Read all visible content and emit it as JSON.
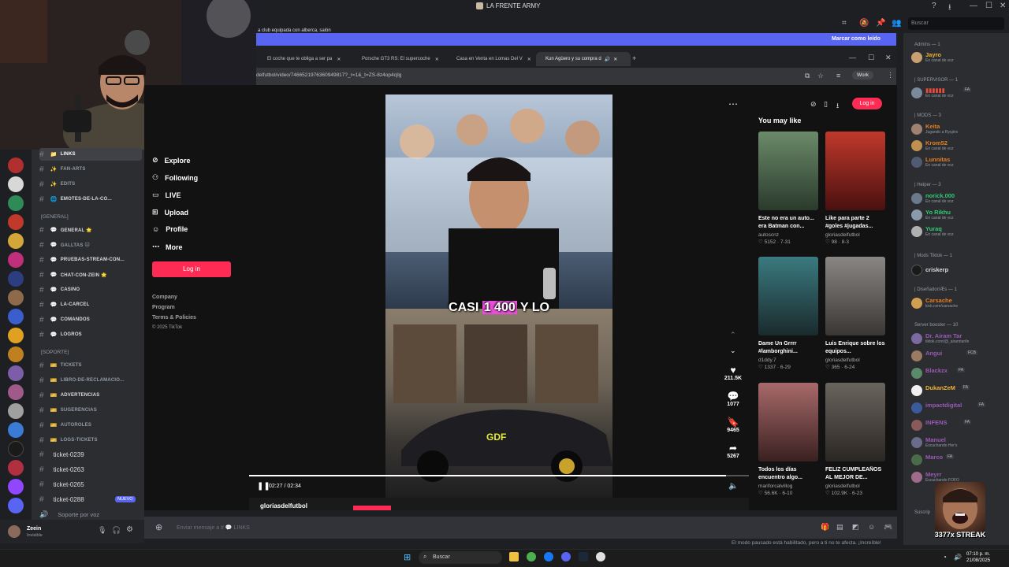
{
  "window": {
    "server_title": "LA FRENTE ARMY",
    "search_placeholder": "Buscar"
  },
  "notification": {
    "text": "a club equipada con alberca, salón",
    "action": "Marcar como leído"
  },
  "browser": {
    "tabs": [
      {
        "label": "El coche que te obliga a ser pa"
      },
      {
        "label": "Porsche GT3 RS: El supercoche"
      },
      {
        "label": "Casa en Venta en Lomas Del V"
      },
      {
        "label": "Kun Agüero y su compra d"
      }
    ],
    "url": "delfutbol/video/7466521976360949817?_r=1&_t=ZS-8z4op4cjlg",
    "profile_label": "Work"
  },
  "tiktok": {
    "nav": [
      "Explore",
      "Following",
      "LIVE",
      "Upload",
      "Profile",
      "More"
    ],
    "login_label": "Log in",
    "footer": [
      "Company",
      "Program",
      "Terms & Policies",
      "© 2025 TikTok"
    ],
    "video": {
      "caption_pre": "CASI ",
      "caption_hl": "1 400",
      "caption_post": " Y LO",
      "overlay": "GDF",
      "time": "02:27 / 02:34",
      "author": "gloriasdelfutbol",
      "progress": 0.955
    },
    "actions": {
      "likes": "211.5K",
      "comments": "1077",
      "saves": "9465",
      "shares": "5267"
    },
    "you_may_like": "You may like",
    "cards": [
      {
        "title": "Este no era un auto... era Batman con...",
        "author": "autoscnz",
        "stats": "♡ 5152 · 7-31",
        "color": "#3b4a3c"
      },
      {
        "title": "Like para parte 2 #goles #jugadas...",
        "author": "gloriasdelfutbol",
        "stats": "♡ 98 · 8-3",
        "color": "#7a2a2a"
      },
      {
        "title": "Dame Un Grrrr #lamborghini...",
        "author": "d1ddy.7",
        "stats": "♡ 1337 · 6-29",
        "color": "#2f5a5e"
      },
      {
        "title": "Luis Enrique sobre los equipos...",
        "author": "gloriasdelfutbol",
        "stats": "♡ 365 · 6-24",
        "color": "#6e6a68"
      },
      {
        "title": "Todos los días encuentro algo...",
        "author": "mariforcalvillog",
        "stats": "♡ 56.6K · 6-10",
        "color": "#8a5a5a"
      },
      {
        "title": "FELIZ CUMPLEAÑOS AL MEJOR DE...",
        "author": "gloriasdelfutbol",
        "stats": "♡ 102.9K · 6-23",
        "color": "#4a4540"
      }
    ]
  },
  "channels": {
    "items": [
      {
        "emo": "📁",
        "label": "LINKS"
      },
      {
        "emo": "✨",
        "label": "FAN-ARTS"
      },
      {
        "emo": "✨",
        "label": "EDITS"
      },
      {
        "emo": "🌐",
        "label": "EMOTES-DE-LA-CO..."
      }
    ],
    "cat_general": "[GENERAL]",
    "general": [
      {
        "emo": "💬",
        "label": "GENERAL 🌟"
      },
      {
        "emo": "💬",
        "label": "GALLTAS 🐱"
      },
      {
        "emo": "💬",
        "label": "PRUEBAS-STREAM-CON..."
      },
      {
        "emo": "💬",
        "label": "CHAT-CON-ZEIN 🌟"
      },
      {
        "emo": "💬",
        "label": "CASINO"
      },
      {
        "emo": "💬",
        "label": "LA-CARCEL"
      },
      {
        "emo": "💬",
        "label": "COMANDOS"
      },
      {
        "emo": "💬",
        "label": "LOGROS"
      }
    ],
    "cat_soporte": "[SOPORTE]",
    "soporte": [
      {
        "emo": "🎫",
        "label": "TICKETS"
      },
      {
        "emo": "🎫",
        "label": "LIBRO-DE-RECLAMACIO..."
      },
      {
        "emo": "🎫",
        "label": "ADVERTENCIAS"
      },
      {
        "emo": "🎫",
        "label": "SUGERENCIAS"
      },
      {
        "emo": "🎫",
        "label": "AUTOROLES"
      },
      {
        "emo": "🎫",
        "label": "LOGS-TICKETS"
      }
    ],
    "tickets": [
      "ticket-0239",
      "ticket-0263",
      "ticket-0265",
      "ticket-0288"
    ],
    "new_badge": "NUEVO",
    "voice": "Soporte por voz"
  },
  "user": {
    "name": "Zeein",
    "status": "Invisible"
  },
  "members": {
    "cat_admins": "Admins — 1",
    "cat_supervisor": "| SUPERVISOR — 1",
    "cat_mods": "| MODS — 3",
    "cat_helper": "| Helper — 3",
    "cat_modstiktok": "| Mods Tiktok — 1",
    "cat_disenador": "| Diseñador/Æs — 1",
    "cat_booster": "Server booster — 10",
    "cat_suscrip": "Suscrip",
    "list": [
      {
        "name": "Jayro",
        "sub": "En canal de voz",
        "color": "#f0b232"
      },
      {
        "name": "▮▮▮▮▮▮",
        "sub": "En canal de voz",
        "color": "#e74c3c"
      },
      {
        "name": "Keita",
        "sub": "Jugando a Ryujinx",
        "color": "#e67e22"
      },
      {
        "name": "Krom52",
        "sub": "En canal de voz",
        "color": "#e67e22"
      },
      {
        "name": "Lunnitas",
        "sub": "En canal de voz",
        "color": "#e67e22"
      },
      {
        "name": "norick.000",
        "sub": "En canal de voz",
        "color": "#2ecc71"
      },
      {
        "name": "Yo Rikhu",
        "sub": "En canal de voz",
        "color": "#2ecc71"
      },
      {
        "name": "Yuraq",
        "sub": "En canal de voz",
        "color": "#2ecc71"
      },
      {
        "name": "criskerp",
        "sub": "",
        "color": "#dbdee1"
      },
      {
        "name": "Carsache",
        "sub": "kick.com/carsache",
        "color": "#e67e22"
      },
      {
        "name": "Dr. Airam Tar",
        "sub": "tiktok.com/@_airamtarife",
        "color": "#9b59b6"
      },
      {
        "name": "Angui",
        "sub": "",
        "color": "#9b59b6"
      },
      {
        "name": "Blackzx",
        "sub": "",
        "color": "#9b59b6"
      },
      {
        "name": "DukanZeM",
        "sub": "",
        "color": "#f0b232"
      },
      {
        "name": "impactdigital",
        "sub": "",
        "color": "#9b59b6"
      },
      {
        "name": "INFENS",
        "sub": "",
        "color": "#9b59b6"
      },
      {
        "name": "Manuel",
        "sub": "Escuchando Her's",
        "color": "#9b59b6"
      },
      {
        "name": "Marco",
        "sub": "",
        "color": "#9b59b6"
      },
      {
        "name": "Meyrr",
        "sub": "Escuchando FOFO",
        "color": "#9b59b6"
      }
    ]
  },
  "streak": "3377x STREAK",
  "chat": {
    "placeholder": "Enviar mensaje a # 💬 LINKS",
    "slowmode": "El modo pausado está habilitado, pero a ti no te afecta. ¡Increíble!"
  },
  "taskbar": {
    "search": "Buscar",
    "time": "07:10 p. m.",
    "date": "21/08/2025"
  }
}
